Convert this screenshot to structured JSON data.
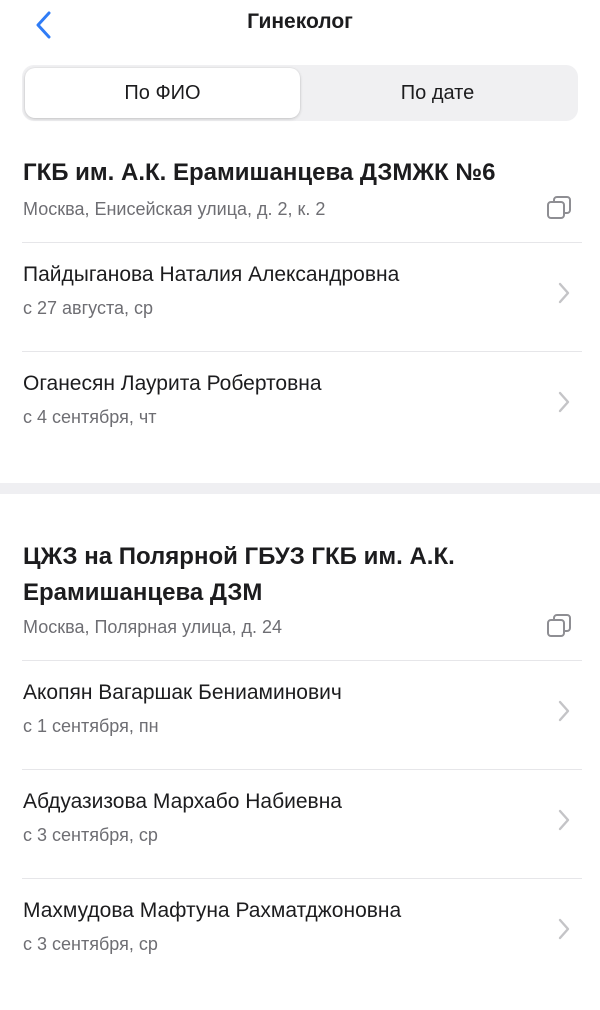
{
  "header": {
    "title": "Гинеколог"
  },
  "segment": {
    "by_name": "По ФИО",
    "by_date": "По дате"
  },
  "clinics": [
    {
      "name": "ГКБ им. А.К. Ерамишанцева ДЗМЖК №6",
      "address": "Москва, Енисейская улица, д. 2, к. 2",
      "doctors": [
        {
          "name": "Пайдыганова Наталия Александровна",
          "date": "с 27 августа, ср"
        },
        {
          "name": "Оганесян Лаурита Робертовна",
          "date": "с 4 сентября, чт"
        }
      ]
    },
    {
      "name": "ЦЖЗ на Полярной ГБУЗ ГКБ им. А.К. Ерамишанцева ДЗМ",
      "address": "Москва, Полярная улица, д. 24",
      "doctors": [
        {
          "name": "Акопян Вагаршак Бениаминович",
          "date": "с 1 сентября, пн"
        },
        {
          "name": "Абдуазизова Мархабо Набиевна",
          "date": "с 3 сентября, ср"
        },
        {
          "name": "Махмудова Мафтуна Рахматджоновна",
          "date": "с 3 сентября, ср"
        }
      ]
    }
  ],
  "colors": {
    "accent": "#2f7cf6",
    "secondary_text": "#6e6e73",
    "chevron": "#c4c4c7"
  }
}
